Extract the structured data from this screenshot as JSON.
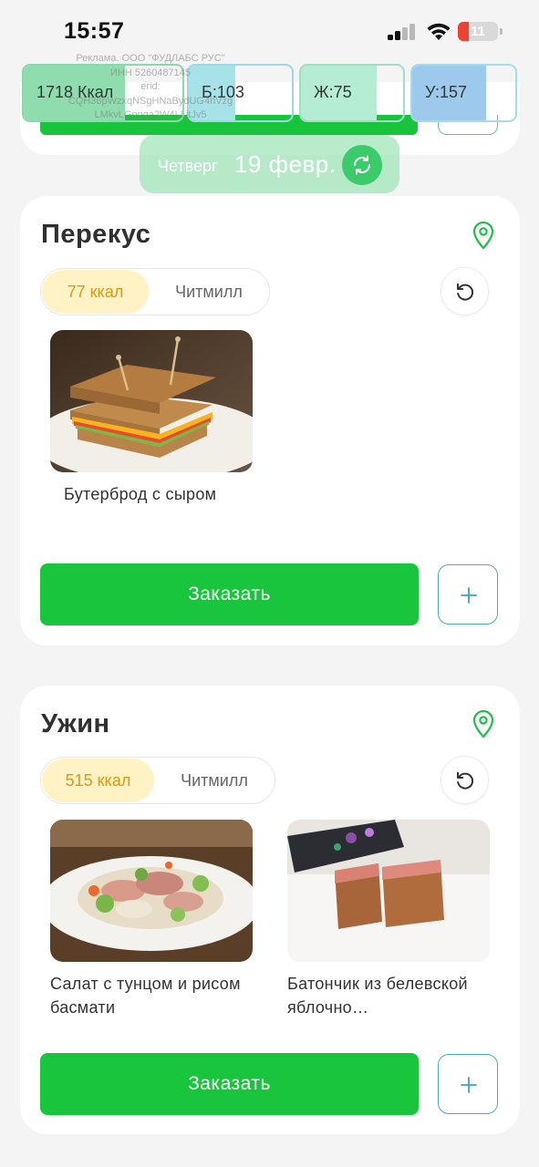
{
  "status_bar": {
    "time": "15:57",
    "battery_level": "11",
    "signal_icon": "cellular-signal-icon",
    "wifi_icon": "wifi-icon",
    "battery_icon": "battery-icon"
  },
  "ad": {
    "lines": [
      "Реклама. ООО \"ФУДЛАБС РУС\"",
      "ИНН 5260487145",
      "erid:",
      "CQH36pWzxqNSgHNaBydUG4hVzg",
      "LMkvLGpqga2W4LLitJv5"
    ]
  },
  "macros": [
    {
      "label": "1718 Ккал",
      "fill_fraction": 0.64,
      "fill": "#8fdcae",
      "border": "#8ad9ab"
    },
    {
      "label": "Б:103",
      "fill_fraction": 0.45,
      "fill": "#a6e3e8",
      "border": "#9ed8e6"
    },
    {
      "label": "Ж:75",
      "fill_fraction": 0.74,
      "fill": "#b5ecd4",
      "border": "#a3dcc7"
    },
    {
      "label": "У:157",
      "fill_fraction": 0.72,
      "fill": "#9cc9ec",
      "border": "#a6dbe9"
    }
  ],
  "date_pill": {
    "day_of_week": "Четверг",
    "date": "19 февр.",
    "refresh_icon": "refresh-icon"
  },
  "meals": [
    {
      "title": "Перекус",
      "kcal": "77 ккал",
      "provider": "Читмилл",
      "dishes": [
        {
          "name": "Бутерброд с сыром"
        }
      ],
      "order_label": "Заказать"
    },
    {
      "title": "Ужин",
      "kcal": "515 ккал",
      "provider": "Читмилл",
      "dishes": [
        {
          "name": "Салат с тунцом и рисом басмати"
        },
        {
          "name": "Батончик из белевской яблочно…"
        }
      ],
      "order_label": "Заказать"
    }
  ],
  "colors": {
    "accent_green": "#1ac53e",
    "kcal_badge_bg": "#fff2c4",
    "kcal_badge_text": "#d99a15",
    "add_button_border": "#4aa9c7"
  }
}
